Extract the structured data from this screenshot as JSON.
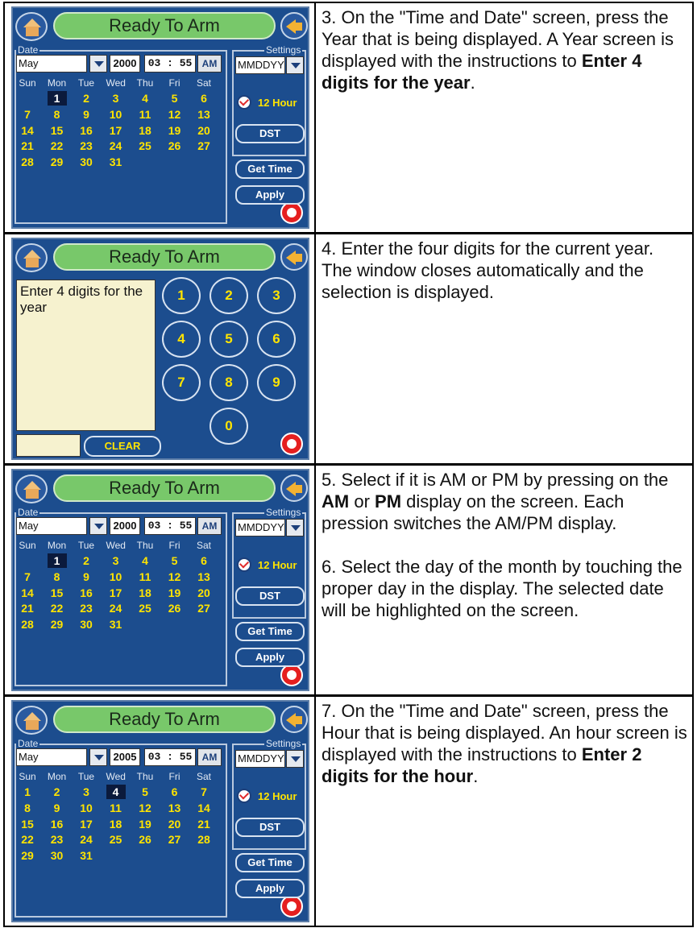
{
  "screen_title": "Ready To Arm",
  "labels": {
    "date_group": "Date",
    "settings_group": "Settings",
    "format": "MMDDYY",
    "twelve_hour": "12 Hour",
    "dst": "DST",
    "get_time": "Get Time",
    "apply": "Apply",
    "ampm": "AM",
    "time": "03 : 55",
    "clear": "CLEAR"
  },
  "weekdays": [
    "Sun",
    "Mon",
    "Tue",
    "Wed",
    "Thu",
    "Fri",
    "Sat"
  ],
  "screens": [
    {
      "type": "calendar",
      "month": "May",
      "year": "2000",
      "start_weekday": 1,
      "num_days": 31,
      "selected_day": 1,
      "text": [
        [
          {
            "t": "3.  On the \"Time and Date\" screen, press the Year that is being displayed.  A Year screen is displayed with the instructions to "
          },
          {
            "t": "Enter 4 digits for the year",
            "b": true
          },
          {
            "t": "."
          }
        ]
      ]
    },
    {
      "type": "keypad",
      "prompt": "Enter 4 digits for the year",
      "keys": [
        "1",
        "2",
        "3",
        "4",
        "5",
        "6",
        "7",
        "8",
        "9",
        "0"
      ],
      "text": [
        [
          {
            "t": "4.  Enter the four digits for the current year."
          }
        ],
        [
          {
            "t": "The window closes automatically and the selection is displayed."
          }
        ]
      ]
    },
    {
      "type": "calendar",
      "month": "May",
      "year": "2000",
      "start_weekday": 1,
      "num_days": 31,
      "selected_day": 1,
      "text": [
        [
          {
            "t": "5.  Select if it is AM or PM by pressing on the "
          },
          {
            "t": "AM",
            "b": true
          },
          {
            "t": " or "
          },
          {
            "t": "PM",
            "b": true
          },
          {
            "t": " display on the screen. Each pression switches the AM/PM display."
          }
        ],
        [],
        [
          {
            "t": "6. Select the day of the month by touching the proper day in the display. The selected date will be highlighted on the screen."
          }
        ]
      ]
    },
    {
      "type": "calendar",
      "month": "May",
      "year": "2005",
      "start_weekday": 0,
      "num_days": 31,
      "selected_day": 4,
      "text": [
        [
          {
            "t": "7. On the \"Time and Date\" screen, press the Hour that is being displayed.  An hour screen is displayed with the instructions to "
          },
          {
            "t": "Enter 2 digits for the hour",
            "b": true
          },
          {
            "t": "."
          }
        ]
      ]
    }
  ]
}
